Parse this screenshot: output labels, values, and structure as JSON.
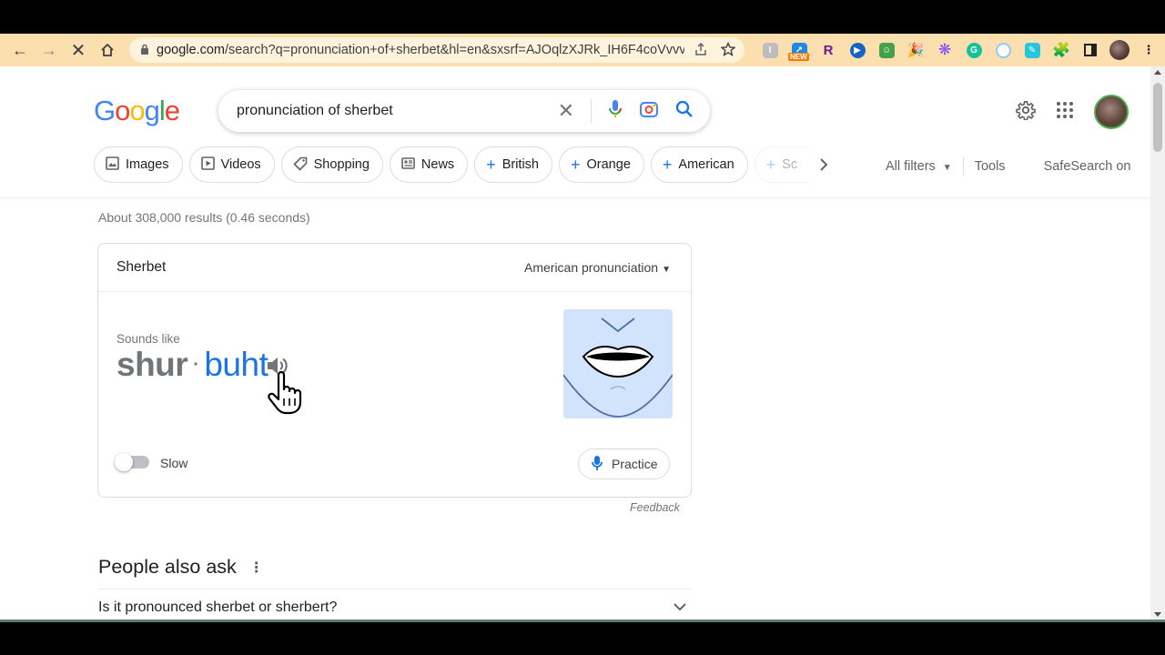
{
  "browser": {
    "url_host": "google.com",
    "url_rest": "/search?q=pronunciation+of+sherbet&hl=en&sxsrf=AJOqlzXJRk_IH6F4coVvvv...",
    "ext_new_badge": "NEW",
    "ext_r_label": "R"
  },
  "search": {
    "logo": [
      "G",
      "o",
      "o",
      "g",
      "l",
      "e"
    ],
    "logo_colors": [
      "#4285f4",
      "#ea4335",
      "#fbbc05",
      "#4285f4",
      "#34a853",
      "#ea4335"
    ],
    "query": "pronunciation of sherbet"
  },
  "chips": [
    {
      "label": "Images",
      "icon": "image-icon"
    },
    {
      "label": "Videos",
      "icon": "video-icon"
    },
    {
      "label": "Shopping",
      "icon": "tag-icon"
    },
    {
      "label": "News",
      "icon": "news-icon"
    },
    {
      "label": "British",
      "icon": "plus-icon"
    },
    {
      "label": "Orange",
      "icon": "plus-icon"
    },
    {
      "label": "American",
      "icon": "plus-icon"
    },
    {
      "label": "Sc",
      "icon": "plus-icon"
    }
  ],
  "filters": {
    "all_filters": "All filters",
    "tools": "Tools",
    "safesearch": "SafeSearch on"
  },
  "results": {
    "stats": "About 308,000 results (0.46 seconds)"
  },
  "pronunciation": {
    "word": "Sherbet",
    "accent": "American pronunciation",
    "sounds_like": "Sounds like",
    "syllable_1": "shur",
    "separator": "·",
    "syllable_2": "buht",
    "slow_label": "Slow",
    "practice_label": "Practice",
    "feedback": "Feedback"
  },
  "paa": {
    "title": "People also ask",
    "questions": [
      "Is it pronounced sherbet or sherbert?"
    ]
  },
  "colors": {
    "toolbar": "#fbdfae",
    "link_blue": "#1a73e8",
    "mouth_bg": "#d2e3fc"
  }
}
